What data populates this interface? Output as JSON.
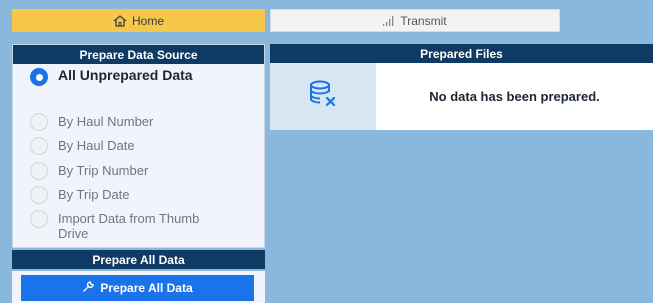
{
  "tabs": {
    "home": {
      "label": "Home",
      "icon": "home-icon",
      "color": "#f6c84a"
    },
    "transmit": {
      "label": "Transmit",
      "icon": "signal-icon"
    }
  },
  "prepare_source": {
    "title": "Prepare Data Source",
    "options": [
      {
        "label": "All Unprepared Data",
        "selected": true
      },
      {
        "label": "By Haul Number",
        "selected": false
      },
      {
        "label": "By Haul Date",
        "selected": false
      },
      {
        "label": "By Trip Number",
        "selected": false
      },
      {
        "label": "By Trip Date",
        "selected": false
      },
      {
        "label": "Import Data from Thumb Drive",
        "selected": false
      }
    ]
  },
  "prepare_all": {
    "title": "Prepare All Data",
    "button_label": "Prepare All Data",
    "button_icon": "wrench-icon"
  },
  "prepared_files": {
    "title": "Prepared Files",
    "empty_icon": "database-x-icon",
    "empty_message": "No data has been prepared."
  },
  "colors": {
    "header": "#0f3a63",
    "accent": "#1a73e8",
    "background": "#8ab7dc"
  }
}
